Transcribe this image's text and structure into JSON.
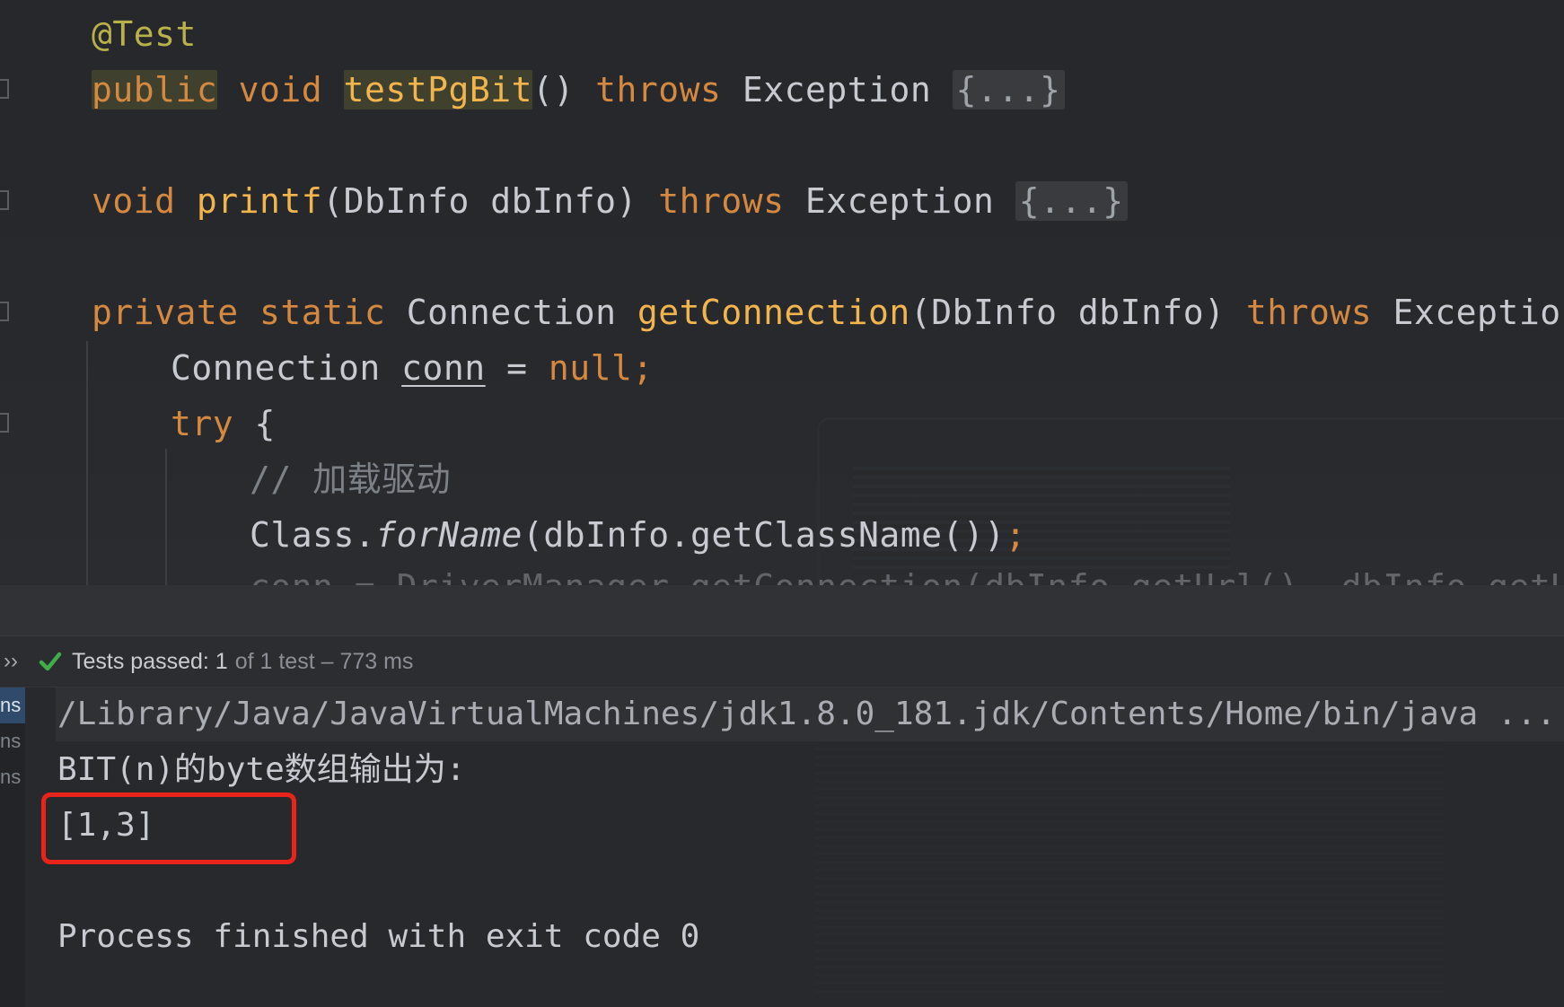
{
  "editor": {
    "annotation": "@Test",
    "line_test": {
      "kw_public": "public",
      "kw_void": "void",
      "method": "testPgBit",
      "parens": "()",
      "kw_throws": "throws",
      "exception": "Exception",
      "fold": "{...}"
    },
    "line_printf": {
      "kw_void": "void",
      "method": "printf",
      "params": "(DbInfo dbInfo)",
      "kw_throws": "throws",
      "exception": "Exception",
      "fold": "{...}"
    },
    "line_getconn": {
      "kw_private": "private",
      "kw_static": "static",
      "type": "Connection",
      "method": "getConnection",
      "params": "(DbInfo dbInfo)",
      "kw_throws": "throws",
      "exception": "Exception",
      "brace": "{"
    },
    "line_conn": {
      "type": "Connection",
      "var": "conn",
      "eq": "=",
      "null": "null;"
    },
    "line_try": {
      "kw_try": "try",
      "brace": "{"
    },
    "line_comment": "// 加载驱动",
    "line_forname": {
      "cls": "Class.",
      "method": "forName",
      "args": "(dbInfo.getClassName())",
      "semi": ";"
    },
    "line_cut": "conn = DriverManager.getConnection(dbInfo.getUrl(), dbInfo.getUser("
  },
  "status": {
    "collapse_icon": "chevron-double-right",
    "check_icon": "check-icon",
    "passed_label": "Tests passed: 1",
    "detail": "of 1 test – 773 ms",
    "accent": "#3fae49"
  },
  "rail": {
    "items": [
      "ns",
      "ns",
      "ns"
    ]
  },
  "console": {
    "java_path": "/Library/Java/JavaVirtualMachines/jdk1.8.0_181.jdk/Contents/Home/bin/java ...",
    "output_label": "BIT(n)的byte数组输出为:",
    "output_value": "[1,3]",
    "exit_message": "Process finished with exit code 0",
    "highlight_color": "#e8241b"
  }
}
